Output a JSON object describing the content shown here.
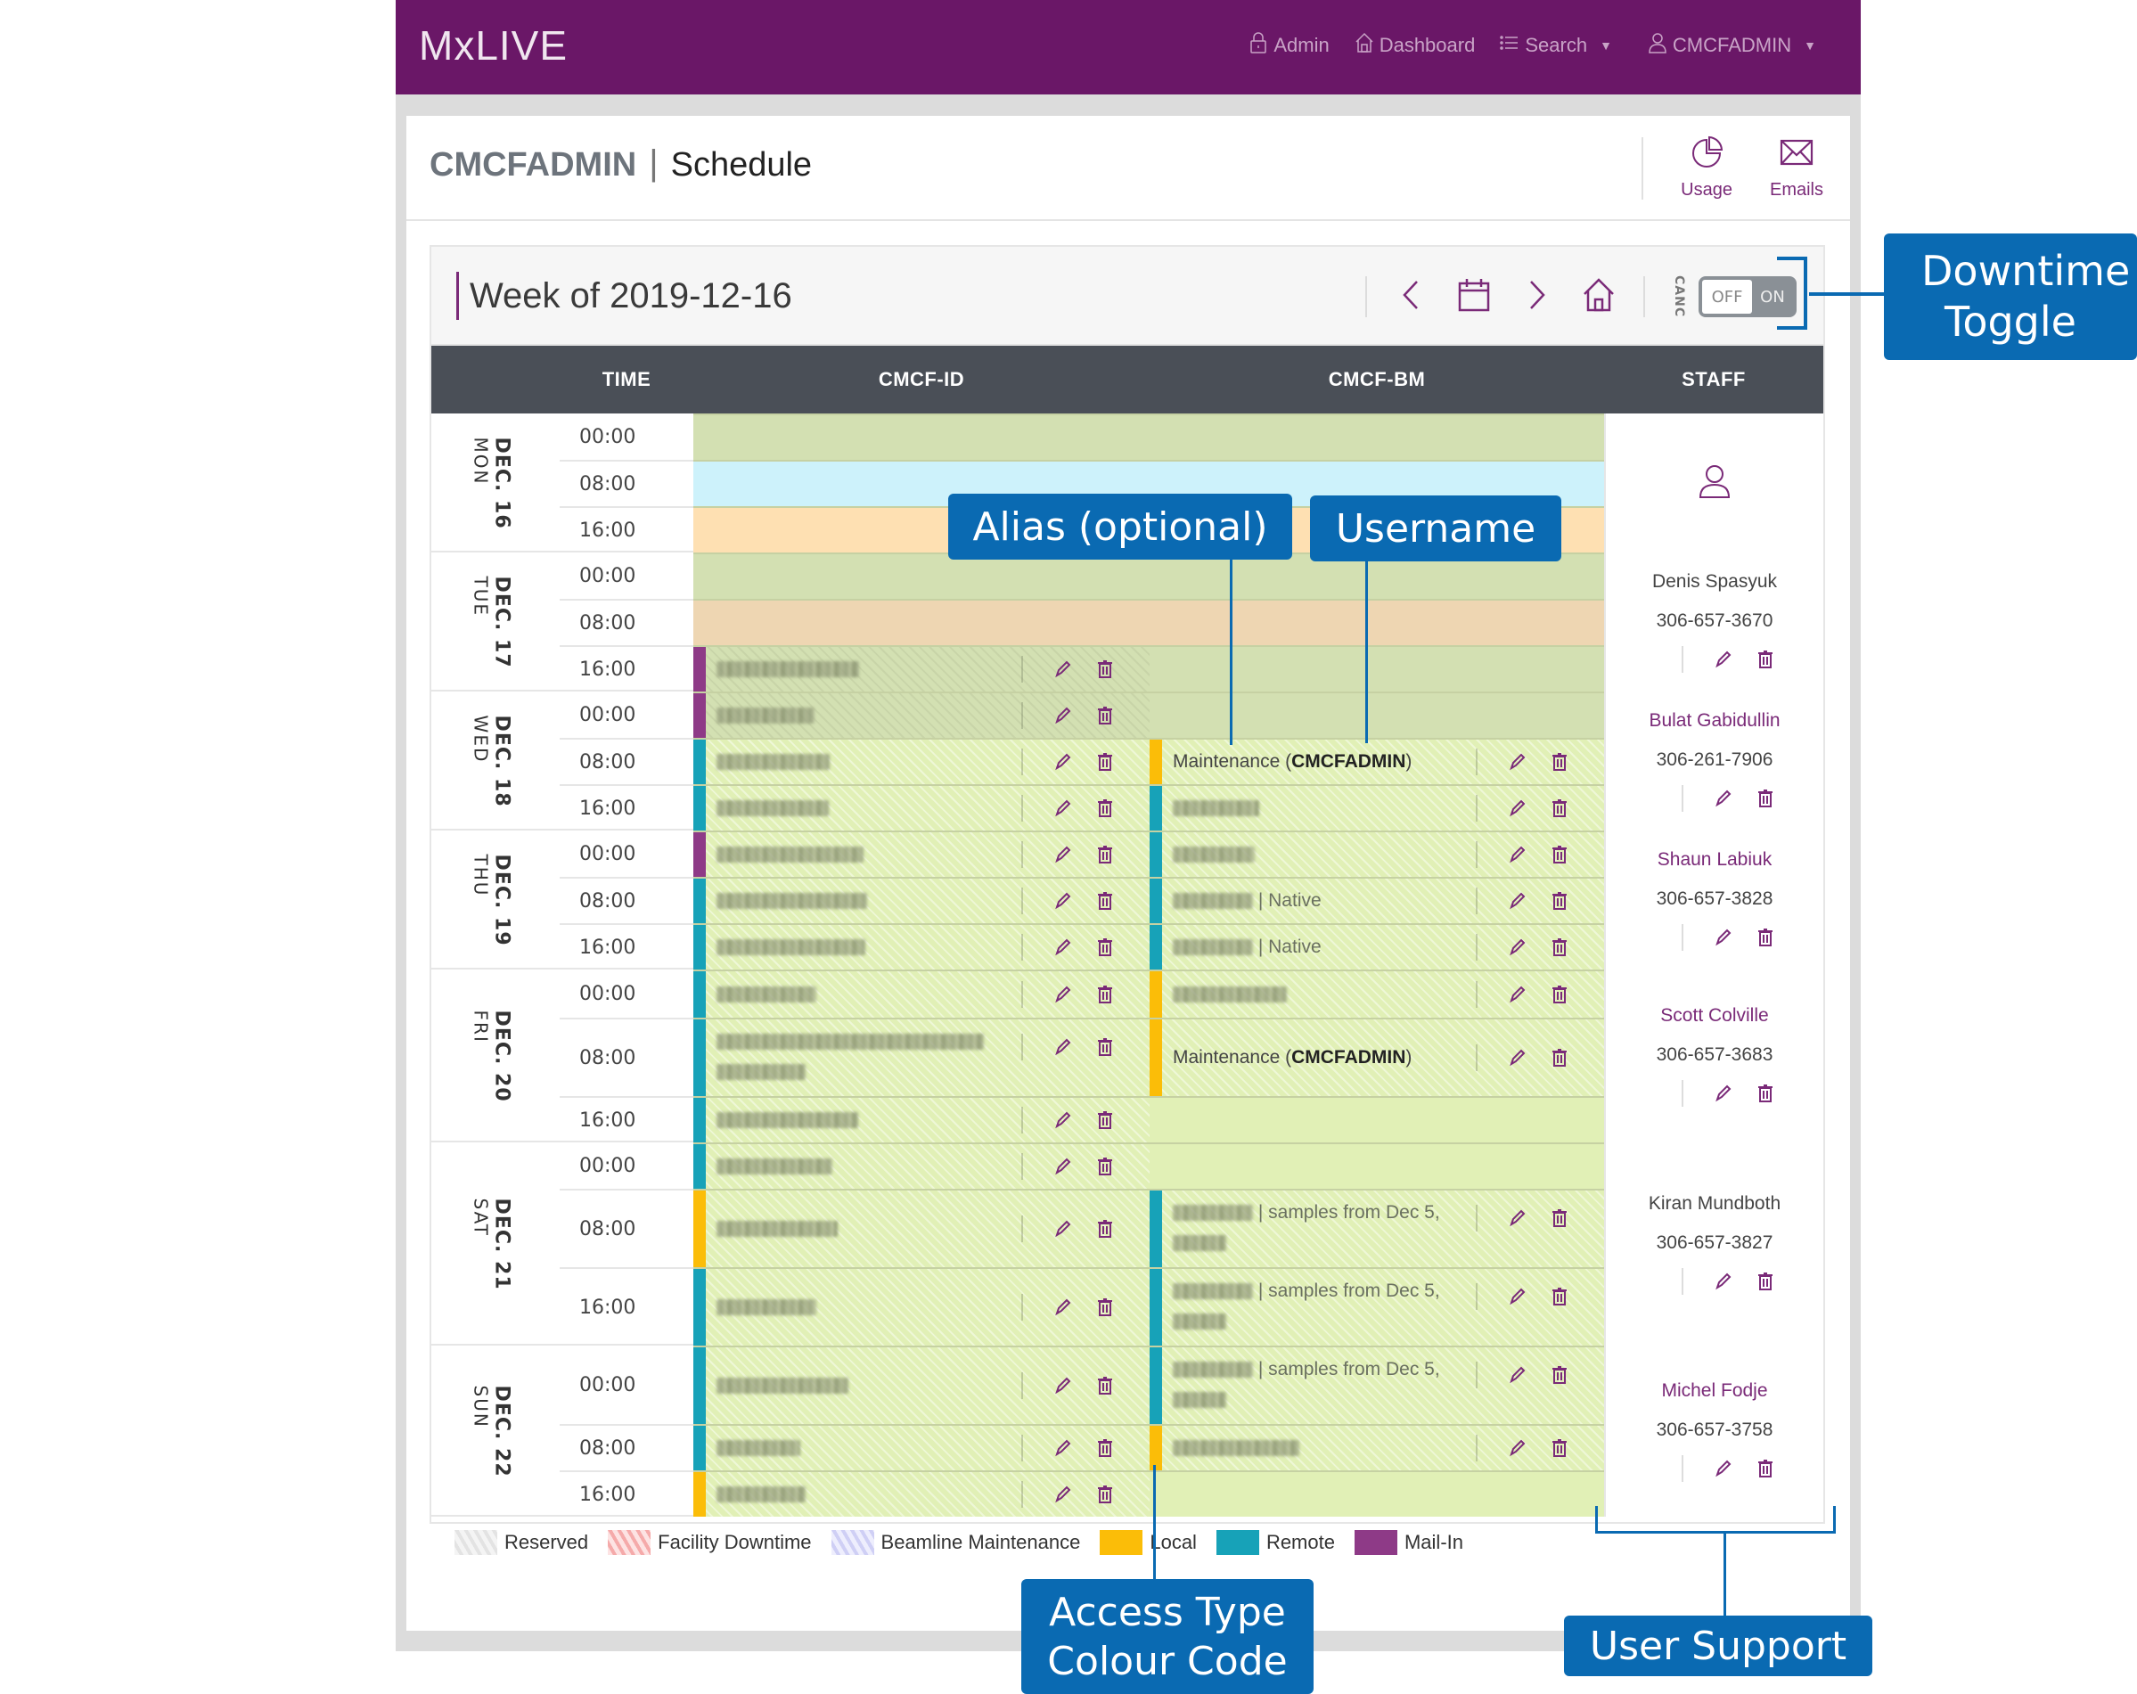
{
  "nav": {
    "brand": "MxLIVE",
    "links": [
      {
        "label": "Admin",
        "icon": "lock-icon"
      },
      {
        "label": "Dashboard",
        "icon": "home-icon"
      },
      {
        "label": "Search",
        "icon": "list-icon",
        "dropdown": true
      },
      {
        "label": "CMCFADMIN",
        "icon": "user-icon",
        "dropdown": true
      }
    ]
  },
  "page": {
    "user": "CMCFADMIN",
    "separator": "|",
    "title": "Schedule",
    "actions": [
      {
        "label": "Usage",
        "icon": "pie-chart-icon"
      },
      {
        "label": "Emails",
        "icon": "envelope-icon"
      }
    ]
  },
  "schedule": {
    "week_title": "Week of 2019-12-16",
    "toggle": {
      "side_label": "CANC",
      "off_label": "OFF",
      "on_label": "ON",
      "state": "OFF"
    },
    "columns": {
      "time": "TIME",
      "beamline1": "CMCF-ID",
      "beamline2": "CMCF-BM",
      "staff": "STAFF"
    },
    "days": [
      {
        "date": "DEC. 16",
        "dow": "MON",
        "slots": [
          {
            "time": "00:00"
          },
          {
            "time": "08:00"
          },
          {
            "time": "16:00"
          }
        ],
        "staff": null
      },
      {
        "date": "DEC. 17",
        "dow": "TUE",
        "slots": [
          {
            "time": "00:00"
          },
          {
            "time": "08:00"
          },
          {
            "time": "16:00"
          }
        ],
        "staff": {
          "name": "Denis Spasyuk",
          "phone": "306-657-3670",
          "link": false
        }
      },
      {
        "date": "DEC. 18",
        "dow": "WED",
        "slots": [
          {
            "time": "00:00"
          },
          {
            "time": "08:00"
          },
          {
            "time": "16:00"
          }
        ],
        "staff": {
          "name": "Bulat Gabidullin",
          "phone": "306-261-7906",
          "link": true
        }
      },
      {
        "date": "DEC. 19",
        "dow": "THU",
        "slots": [
          {
            "time": "00:00"
          },
          {
            "time": "08:00"
          },
          {
            "time": "16:00"
          }
        ],
        "staff": {
          "name": "Shaun Labiuk",
          "phone": "306-657-3828",
          "link": true
        }
      },
      {
        "date": "DEC. 20",
        "dow": "FRI",
        "slots": [
          {
            "time": "00:00"
          },
          {
            "time": "08:00"
          },
          {
            "time": "16:00"
          }
        ],
        "staff": {
          "name": "Scott Colville",
          "phone": "306-657-3683",
          "link": true
        }
      },
      {
        "date": "DEC. 21",
        "dow": "SAT",
        "slots": [
          {
            "time": "00:00"
          },
          {
            "time": "08:00"
          },
          {
            "time": "16:00"
          }
        ],
        "staff": {
          "name": "Kiran Mundboth",
          "phone": "306-657-3827",
          "link": false
        }
      },
      {
        "date": "DEC. 22",
        "dow": "SUN",
        "slots": [
          {
            "time": "00:00"
          },
          {
            "time": "08:00"
          },
          {
            "time": "16:00"
          }
        ],
        "staff": {
          "name": "Michel Fodje",
          "phone": "306-657-3758",
          "link": true
        }
      }
    ],
    "entries": {
      "maintenance_alias": "Maintenance",
      "maintenance_user": "CMCFADMIN",
      "native": "Native",
      "samples_desc": "samples from Dec 5,",
      "redacted_note": "entries blurred (redacted)"
    },
    "access_colors": {
      "local": "#fbbd08",
      "remote": "#17a2b8",
      "mail_in": "#8e3a87"
    }
  },
  "legend": [
    {
      "label": "Reserved",
      "kind": "reserved"
    },
    {
      "label": "Facility Downtime",
      "kind": "facility"
    },
    {
      "label": "Beamline Maintenance",
      "kind": "beamline"
    },
    {
      "label": "Local",
      "color": "#fbbd08"
    },
    {
      "label": "Remote",
      "color": "#17a2b8"
    },
    {
      "label": "Mail-In",
      "color": "#8e3a87"
    }
  ],
  "annotations": {
    "downtime_toggle": "Downtime Toggle",
    "alias": "Alias (optional)",
    "username": "Username",
    "access_type_line1": "Access Type",
    "access_type_line2": "Colour Code",
    "user_support": "User Support"
  }
}
